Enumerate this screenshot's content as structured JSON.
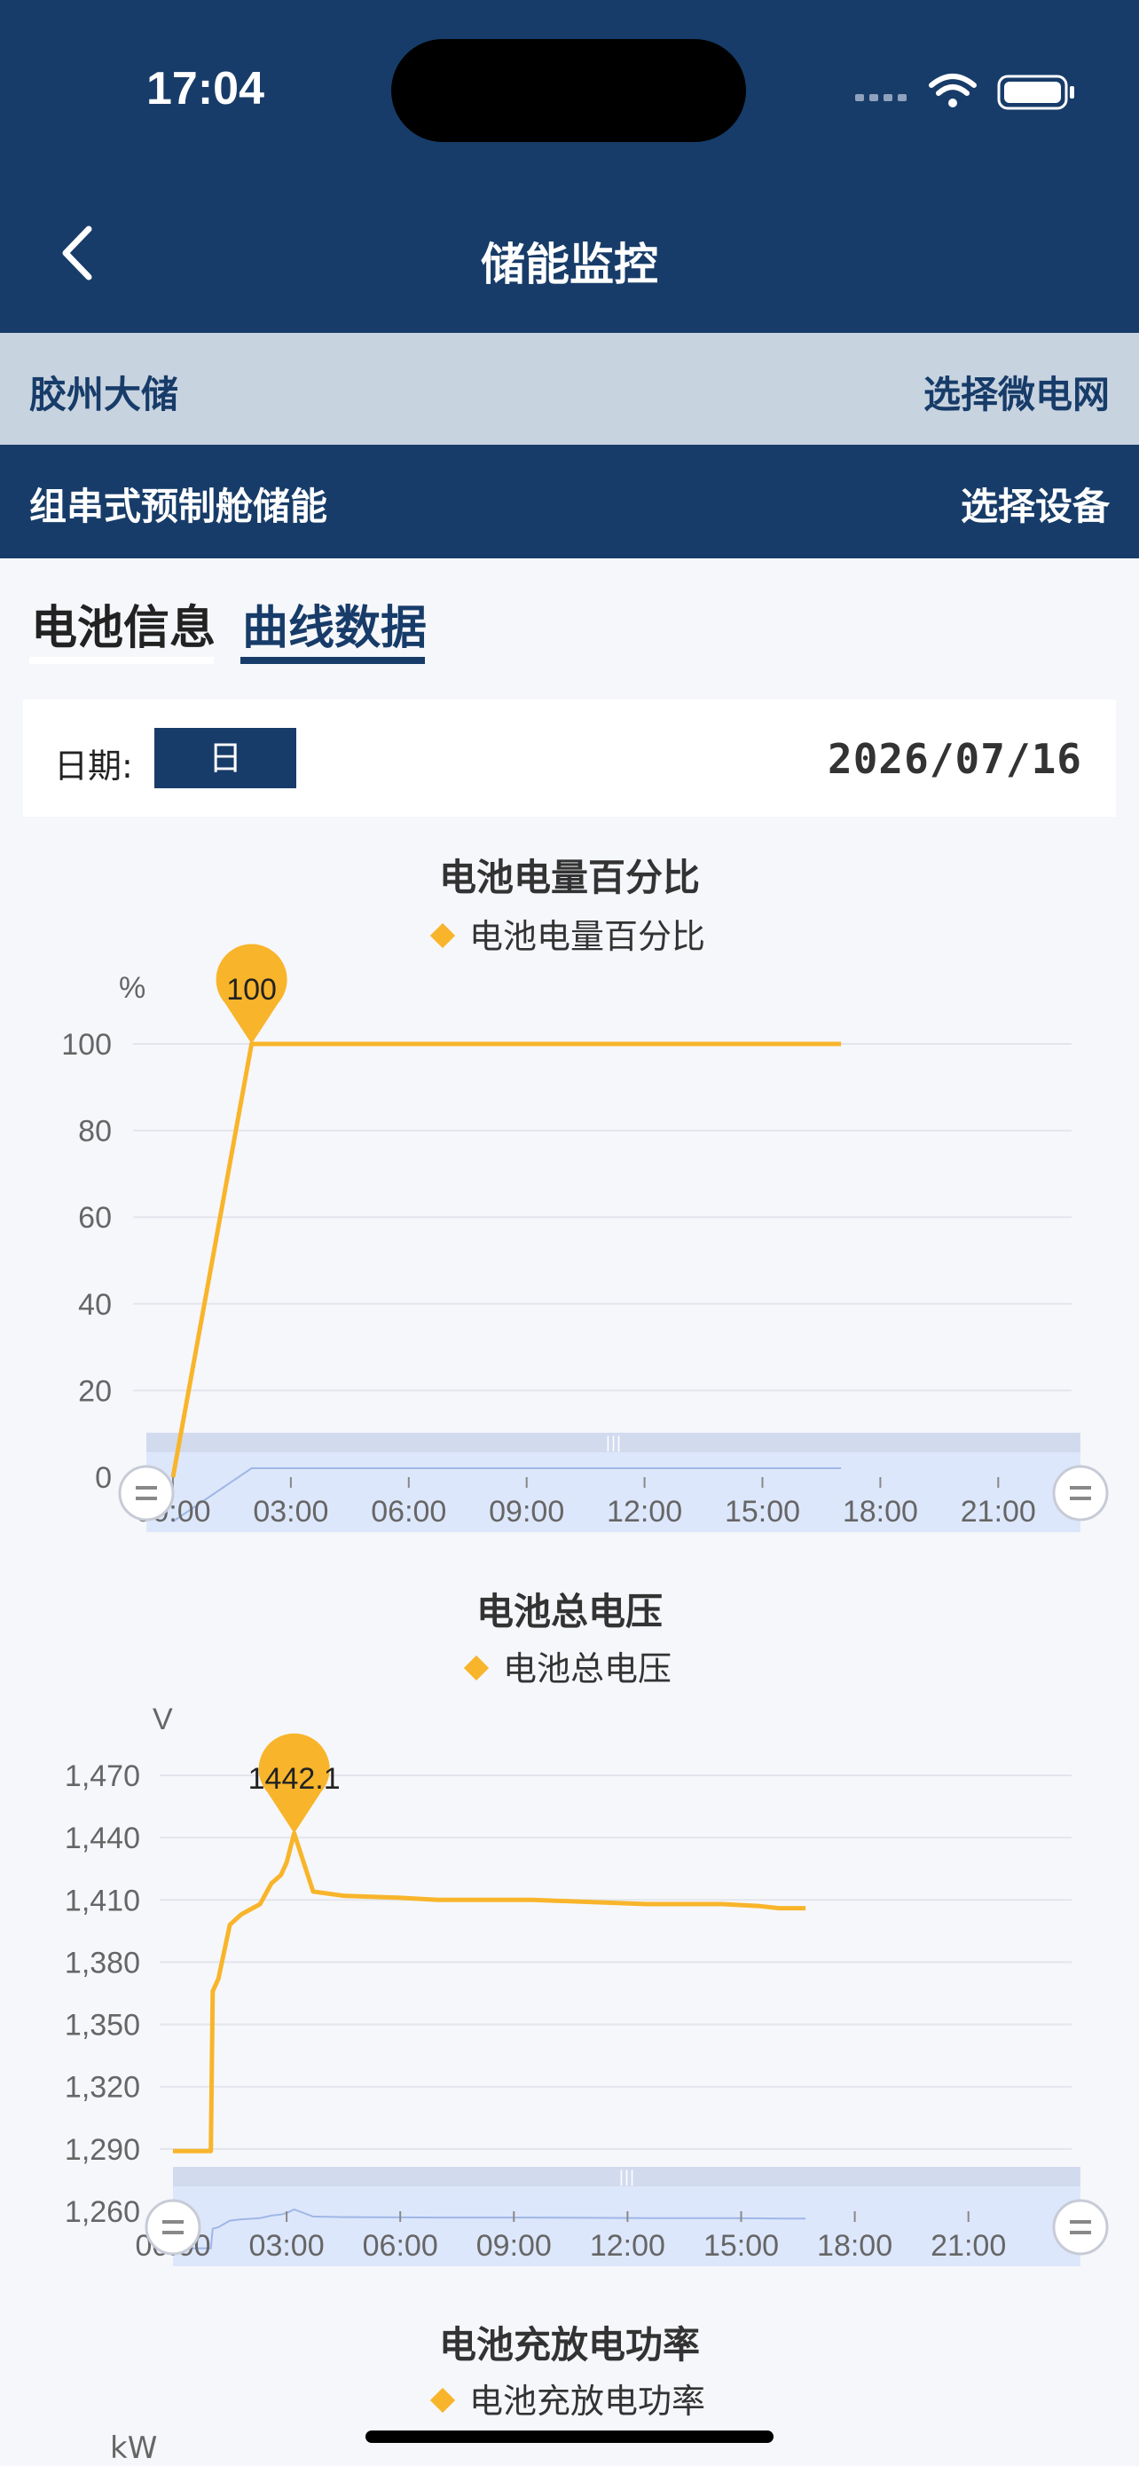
{
  "status_bar": {
    "time": "17:04"
  },
  "header": {
    "title": "储能监控"
  },
  "selector": {
    "site": "胶州大储",
    "site_action": "选择微电网",
    "device": "组串式预制舱储能",
    "device_action": "选择设备"
  },
  "tabs": [
    {
      "label": "电池信息",
      "active": false
    },
    {
      "label": "曲线数据",
      "active": true
    }
  ],
  "date_filter": {
    "label": "日期:",
    "period": "日",
    "date": "2026/07/16"
  },
  "colors": {
    "primary": "#173c69",
    "accent": "#f8b52b",
    "zoom_band": "#dde7fb"
  },
  "chart_data": [
    {
      "type": "line",
      "title": "电池电量百分比",
      "legend": "电池电量百分比",
      "unit": "%",
      "ylim": [
        0,
        100
      ],
      "yticks": [
        "0",
        "20",
        "40",
        "60",
        "80",
        "100"
      ],
      "xticks": [
        "00:00",
        "03:00",
        "06:00",
        "09:00",
        "12:00",
        "15:00",
        "18:00",
        "21:00"
      ],
      "series": [
        {
          "name": "电池电量百分比",
          "x": [
            0.0,
            2.0,
            17.0
          ],
          "y": [
            0,
            100,
            100
          ]
        }
      ],
      "marker": {
        "label": "100",
        "x": 2.0,
        "y": 100
      }
    },
    {
      "type": "line",
      "title": "电池总电压",
      "legend": "电池总电压",
      "unit": "V",
      "ylim": [
        1260,
        1470
      ],
      "yticks": [
        "1,260",
        "1,290",
        "1,320",
        "1,350",
        "1,380",
        "1,410",
        "1,440",
        "1,470"
      ],
      "xticks": [
        "00:00",
        "03:00",
        "06:00",
        "09:00",
        "12:00",
        "15:00",
        "18:00",
        "21:00"
      ],
      "series": [
        {
          "name": "电池总电压",
          "x": [
            0.0,
            1.0,
            1.05,
            1.2,
            1.5,
            1.8,
            2.0,
            2.3,
            2.6,
            2.85,
            3.0,
            3.2,
            3.7,
            4.5,
            6.0,
            7.0,
            9.5,
            11.0,
            12.5,
            14.5,
            15.5,
            16.0,
            16.7
          ],
          "y": [
            1289,
            1289,
            1366,
            1372,
            1398,
            1403,
            1405,
            1408,
            1418,
            1422,
            1428,
            1442.1,
            1414,
            1412,
            1411,
            1410,
            1410,
            1409,
            1408,
            1408,
            1407,
            1406,
            1406
          ]
        }
      ],
      "marker": {
        "label": "1442.1",
        "x": 3.2,
        "y": 1442.1
      }
    },
    {
      "type": "line",
      "title": "电池充放电功率",
      "legend": "电池充放电功率",
      "unit": "kW"
    }
  ]
}
